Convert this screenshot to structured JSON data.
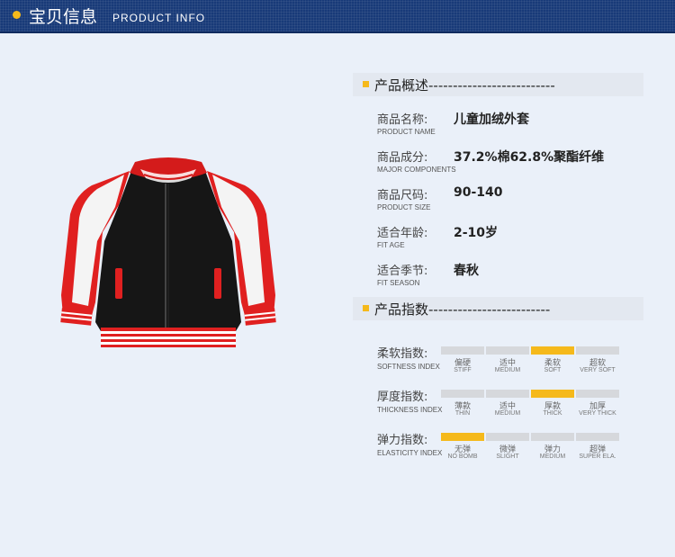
{
  "header": {
    "title_cn": "宝贝信息",
    "title_en": "PRODUCT INFO"
  },
  "overview": {
    "title": "产品概述--------------------------",
    "rows": [
      {
        "label": "商品名称:",
        "label_en": "PRODUCT NAME",
        "value": "儿童加绒外套"
      },
      {
        "label": "商品成分:",
        "label_en": "MAJOR COMPONENTS",
        "value": "37.2%棉62.8%聚酯纤维"
      },
      {
        "label": "商品尺码:",
        "label_en": "PRODUCT SIZE",
        "value": "90-140"
      },
      {
        "label": "适合年龄:",
        "label_en": "FIT AGE",
        "value": "2-10岁"
      },
      {
        "label": "适合季节:",
        "label_en": "FIT SEASON",
        "value": "春秋"
      }
    ]
  },
  "indices": {
    "title": "产品指数-------------------------",
    "items": [
      {
        "label": "柔软指数:",
        "label_en": "SOFTNESS INDEX",
        "selected": 2,
        "options": [
          {
            "cn": "偏硬",
            "en": "STIFF"
          },
          {
            "cn": "适中",
            "en": "MEDIUM"
          },
          {
            "cn": "柔软",
            "en": "SOFT"
          },
          {
            "cn": "超软",
            "en": "VERY SOFT"
          }
        ]
      },
      {
        "label": "厚度指数:",
        "label_en": "THICKNESS INDEX",
        "selected": 2,
        "options": [
          {
            "cn": "薄款",
            "en": "THIN"
          },
          {
            "cn": "适中",
            "en": "MEDIUM"
          },
          {
            "cn": "厚款",
            "en": "THICK"
          },
          {
            "cn": "加厚",
            "en": "VERY THICK"
          }
        ]
      },
      {
        "label": "弹力指数:",
        "label_en": "ELASTICITY INDEX",
        "selected": 0,
        "options": [
          {
            "cn": "无弹",
            "en": "NO BOMB"
          },
          {
            "cn": "微弹",
            "en": "SLIGHT"
          },
          {
            "cn": "弹力",
            "en": "MEDIUM"
          },
          {
            "cn": "超弹",
            "en": "SUPER ELA."
          }
        ]
      }
    ]
  },
  "colors": {
    "accent": "#f5b91b",
    "header_bg": "#183a78",
    "bar_off": "#d6d8dc"
  }
}
